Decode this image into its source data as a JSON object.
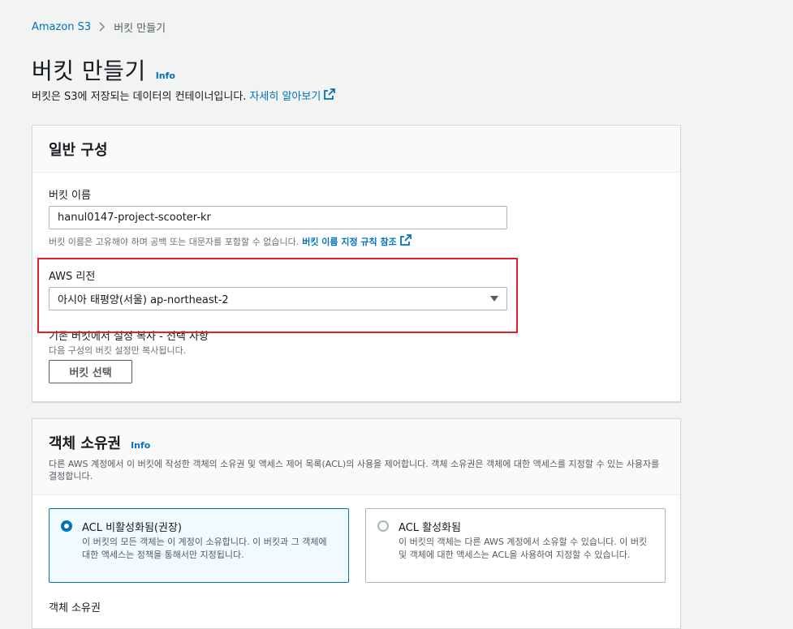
{
  "breadcrumb": {
    "root": "Amazon S3",
    "current": "버킷 만들기"
  },
  "page": {
    "title": "버킷 만들기",
    "info": "Info",
    "description": "버킷은 S3에 저장되는 데이터의 컨테이너입니다.",
    "learn_more": "자세히 알아보기"
  },
  "general": {
    "title": "일반 구성",
    "bucket_name_label": "버킷 이름",
    "bucket_name_value": "hanul0147-project-scooter-kr",
    "bucket_name_hint": "버킷 이름은 고유해야 하며 공백 또는 대문자를 포함할 수 없습니다.",
    "naming_rules_link": "버킷 이름 지정 규칙 참조",
    "region_label": "AWS 리전",
    "region_value": "아시아 태평양(서울) ap-northeast-2",
    "copy_label": "기존 버킷에서 설정 복사 - 선택 사항",
    "copy_hint": "다음 구성의 버킷 설정만 복사됩니다.",
    "choose_bucket_button": "버킷 선택"
  },
  "ownership": {
    "title": "객체 소유권",
    "info": "Info",
    "description": "다른 AWS 계정에서 이 버킷에 작성한 객체의 소유권 및 액세스 제어 목록(ACL)의 사용을 제어합니다. 객체 소유권은 객체에 대한 액세스를 지정할 수 있는 사용자를 결정합니다.",
    "options": [
      {
        "title": "ACL 비활성화됨(권장)",
        "description": "이 버킷의 모든 객체는 이 계정이 소유합니다. 이 버킷과 그 객체에 대한 액세스는 정책을 통해서만 지정됩니다.",
        "selected": true
      },
      {
        "title": "ACL 활성화됨",
        "description": "이 버킷의 객체는 다른 AWS 계정에서 소유할 수 있습니다. 이 버킷 및 객체에 대한 액세스는 ACL을 사용하여 지정할 수 있습니다.",
        "selected": false
      }
    ],
    "bottom_label": "객체 소유권"
  },
  "colors": {
    "link": "#0073bb",
    "highlight": "#e0202b",
    "selected_tile_bg": "#f1faff"
  }
}
